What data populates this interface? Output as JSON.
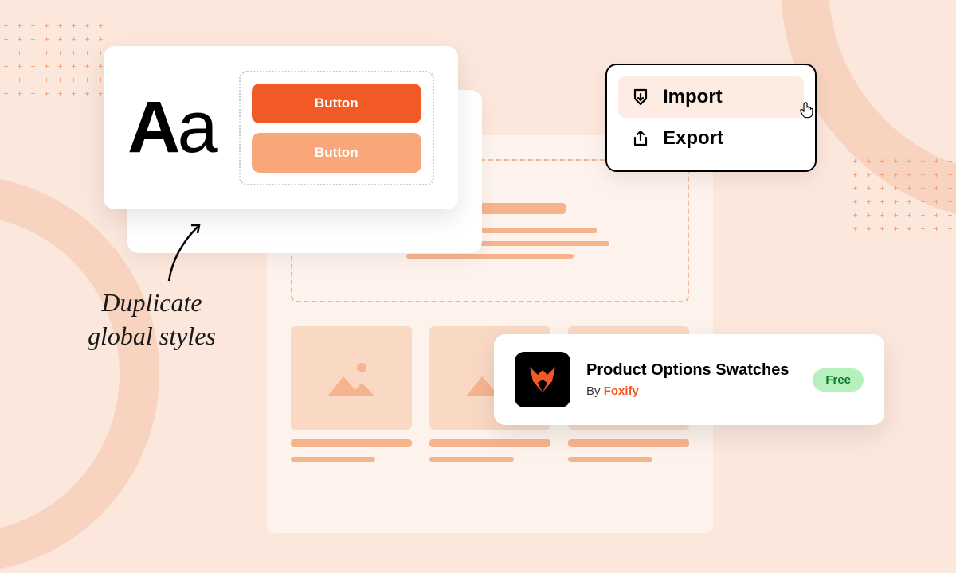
{
  "typography": {
    "sample_upper": "A",
    "sample_lower": "a",
    "button_primary": "Button",
    "button_secondary": "Button"
  },
  "annotation": {
    "line1": "Duplicate",
    "line2": "global styles"
  },
  "io": {
    "import_label": "Import",
    "export_label": "Export"
  },
  "app": {
    "title": "Product Options Swatches",
    "by_prefix": "By ",
    "by_brand": "Foxify",
    "badge": "Free"
  }
}
